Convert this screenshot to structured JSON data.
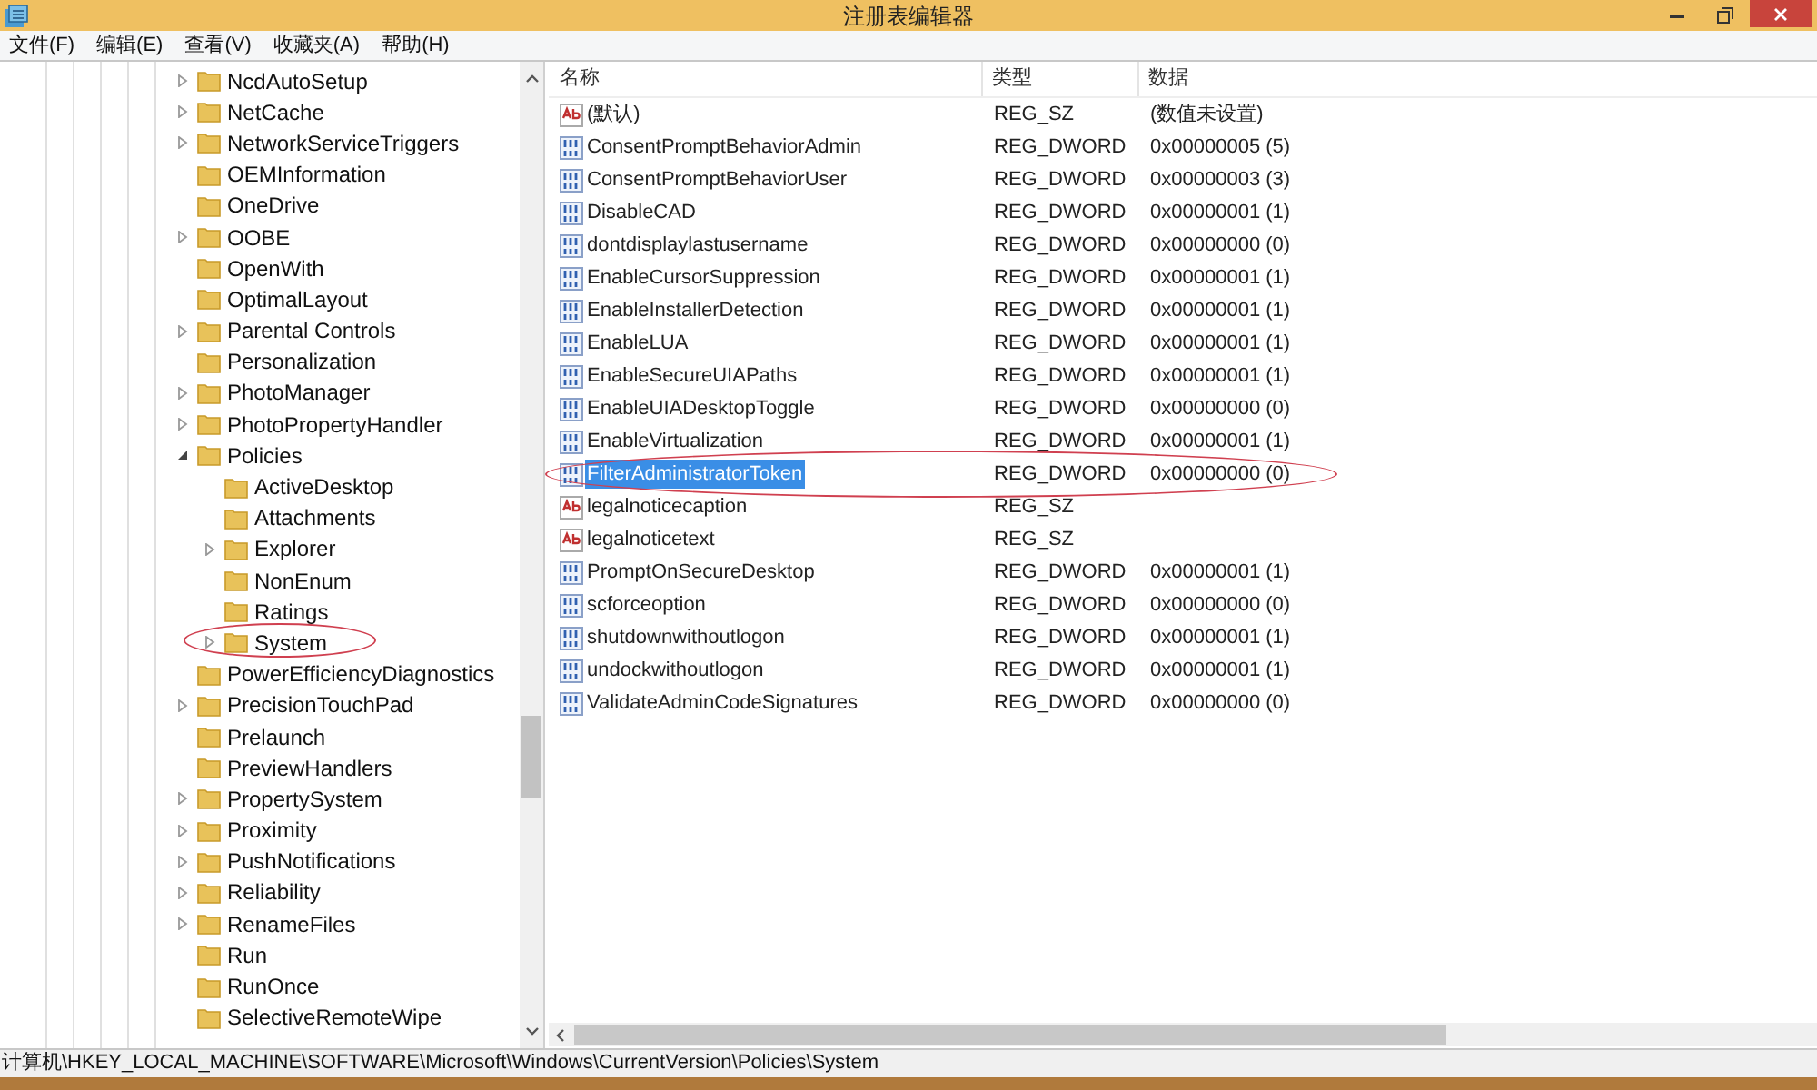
{
  "window": {
    "title": "注册表编辑器"
  },
  "menu": [
    "文件(F)",
    "编辑(E)",
    "查看(V)",
    "收藏夹(A)",
    "帮助(H)"
  ],
  "tree": [
    {
      "label": "NcdAutoSetup",
      "expandable": true,
      "expanded": false
    },
    {
      "label": "NetCache",
      "expandable": true,
      "expanded": false
    },
    {
      "label": "NetworkServiceTriggers",
      "expandable": true,
      "expanded": false
    },
    {
      "label": "OEMInformation",
      "expandable": false
    },
    {
      "label": "OneDrive",
      "expandable": false
    },
    {
      "label": "OOBE",
      "expandable": true,
      "expanded": false
    },
    {
      "label": "OpenWith",
      "expandable": false
    },
    {
      "label": "OptimalLayout",
      "expandable": false
    },
    {
      "label": "Parental Controls",
      "expandable": true,
      "expanded": false
    },
    {
      "label": "Personalization",
      "expandable": false
    },
    {
      "label": "PhotoManager",
      "expandable": true,
      "expanded": false
    },
    {
      "label": "PhotoPropertyHandler",
      "expandable": true,
      "expanded": false
    },
    {
      "label": "Policies",
      "expandable": true,
      "expanded": true,
      "children": [
        {
          "label": "ActiveDesktop",
          "expandable": false
        },
        {
          "label": "Attachments",
          "expandable": false
        },
        {
          "label": "Explorer",
          "expandable": true,
          "expanded": false
        },
        {
          "label": "NonEnum",
          "expandable": false
        },
        {
          "label": "Ratings",
          "expandable": false
        },
        {
          "label": "System",
          "expandable": true,
          "expanded": false,
          "circled": true
        }
      ]
    },
    {
      "label": "PowerEfficiencyDiagnostics",
      "expandable": false
    },
    {
      "label": "PrecisionTouchPad",
      "expandable": true,
      "expanded": false
    },
    {
      "label": "Prelaunch",
      "expandable": false
    },
    {
      "label": "PreviewHandlers",
      "expandable": false
    },
    {
      "label": "PropertySystem",
      "expandable": true,
      "expanded": false
    },
    {
      "label": "Proximity",
      "expandable": true,
      "expanded": false
    },
    {
      "label": "PushNotifications",
      "expandable": true,
      "expanded": false
    },
    {
      "label": "Reliability",
      "expandable": true,
      "expanded": false
    },
    {
      "label": "RenameFiles",
      "expandable": true,
      "expanded": false
    },
    {
      "label": "Run",
      "expandable": false
    },
    {
      "label": "RunOnce",
      "expandable": false
    },
    {
      "label": "SelectiveRemoteWipe",
      "expandable": false
    }
  ],
  "table": {
    "columns": [
      "名称",
      "类型",
      "数据"
    ],
    "rows": [
      {
        "kind": "string",
        "name": "(默认)",
        "type": "REG_SZ",
        "data": "(数值未设置)",
        "selected": false
      },
      {
        "kind": "dword",
        "name": "ConsentPromptBehaviorAdmin",
        "type": "REG_DWORD",
        "data": "0x00000005 (5)",
        "selected": false
      },
      {
        "kind": "dword",
        "name": "ConsentPromptBehaviorUser",
        "type": "REG_DWORD",
        "data": "0x00000003 (3)",
        "selected": false
      },
      {
        "kind": "dword",
        "name": "DisableCAD",
        "type": "REG_DWORD",
        "data": "0x00000001 (1)",
        "selected": false
      },
      {
        "kind": "dword",
        "name": "dontdisplaylastusername",
        "type": "REG_DWORD",
        "data": "0x00000000 (0)",
        "selected": false
      },
      {
        "kind": "dword",
        "name": "EnableCursorSuppression",
        "type": "REG_DWORD",
        "data": "0x00000001 (1)",
        "selected": false
      },
      {
        "kind": "dword",
        "name": "EnableInstallerDetection",
        "type": "REG_DWORD",
        "data": "0x00000001 (1)",
        "selected": false
      },
      {
        "kind": "dword",
        "name": "EnableLUA",
        "type": "REG_DWORD",
        "data": "0x00000001 (1)",
        "selected": false
      },
      {
        "kind": "dword",
        "name": "EnableSecureUIAPaths",
        "type": "REG_DWORD",
        "data": "0x00000001 (1)",
        "selected": false
      },
      {
        "kind": "dword",
        "name": "EnableUIADesktopToggle",
        "type": "REG_DWORD",
        "data": "0x00000000 (0)",
        "selected": false
      },
      {
        "kind": "dword",
        "name": "EnableVirtualization",
        "type": "REG_DWORD",
        "data": "0x00000001 (1)",
        "selected": false
      },
      {
        "kind": "dword",
        "name": "FilterAdministratorToken",
        "type": "REG_DWORD",
        "data": "0x00000000 (0)",
        "selected": true,
        "circled": true
      },
      {
        "kind": "string",
        "name": "legalnoticecaption",
        "type": "REG_SZ",
        "selected": false
      },
      {
        "kind": "string",
        "name": "legalnoticetext",
        "type": "REG_SZ",
        "selected": false
      },
      {
        "kind": "dword",
        "name": "PromptOnSecureDesktop",
        "type": "REG_DWORD",
        "data": "0x00000001 (1)",
        "selected": false
      },
      {
        "kind": "dword",
        "name": "scforceoption",
        "type": "REG_DWORD",
        "data": "0x00000000 (0)",
        "selected": false
      },
      {
        "kind": "dword",
        "name": "shutdownwithoutlogon",
        "type": "REG_DWORD",
        "data": "0x00000001 (1)",
        "selected": false
      },
      {
        "kind": "dword",
        "name": "undockwithoutlogon",
        "type": "REG_DWORD",
        "data": "0x00000001 (1)",
        "selected": false
      },
      {
        "kind": "dword",
        "name": "ValidateAdminCodeSignatures",
        "type": "REG_DWORD",
        "data": "0x00000000 (0)",
        "selected": false
      }
    ]
  },
  "status_bar": "计算机\\HKEY_LOCAL_MACHINE\\SOFTWARE\\Microsoft\\Windows\\CurrentVersion\\Policies\\System"
}
